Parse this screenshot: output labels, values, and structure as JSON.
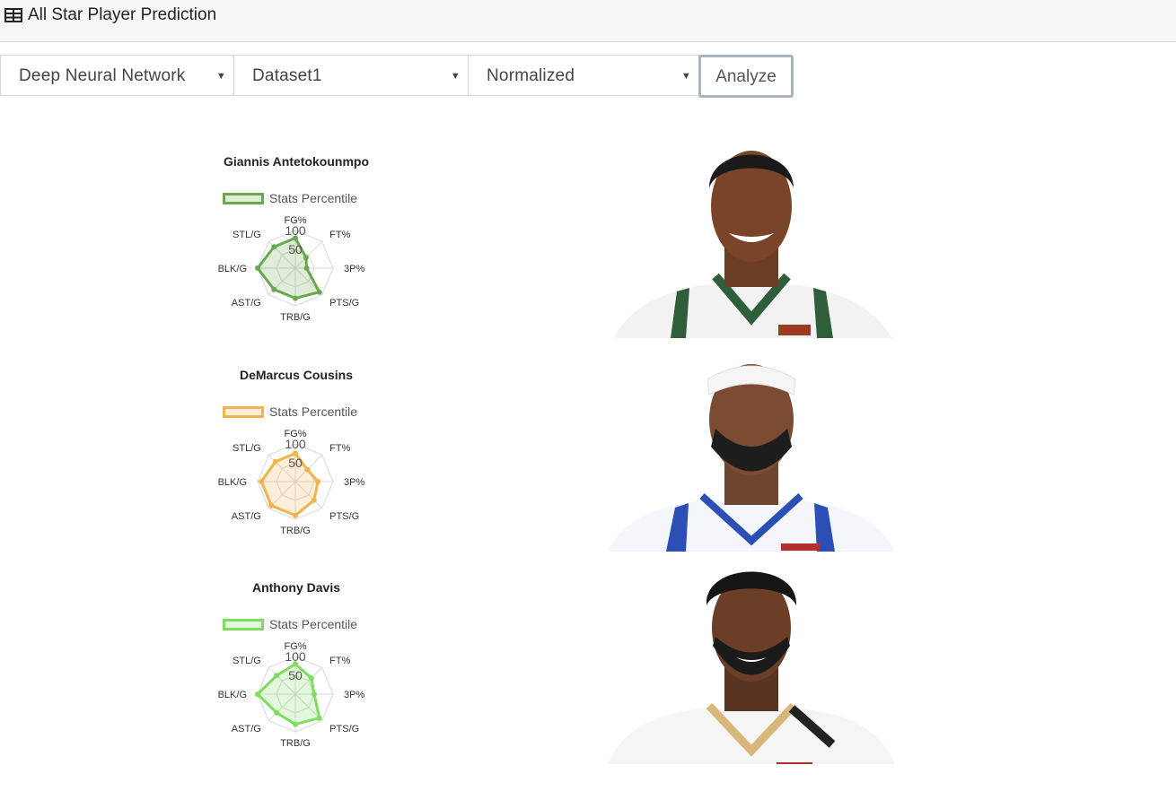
{
  "app": {
    "title": "All Star Player Prediction",
    "icon": "table-icon"
  },
  "controls": {
    "model": "Deep Neural Network",
    "dataset": "Dataset1",
    "normalization": "Normalized",
    "analyze_label": "Analyze"
  },
  "radar_axes": [
    "FG%",
    "FT%",
    "3P%",
    "PTS/G",
    "TRB/G",
    "AST/G",
    "BLK/G",
    "STL/G"
  ],
  "radar_ticks": [
    "50",
    "100"
  ],
  "players": [
    {
      "name": "Giannis Antetokounmpo",
      "legend": "Stats Percentile",
      "color": "#6aa84f",
      "fill": "rgba(106,168,79,0.22)",
      "jersey": "#f2f2f2",
      "trim": "#2e5e3a",
      "values": [
        80,
        40,
        30,
        90,
        80,
        80,
        100,
        80
      ]
    },
    {
      "name": "DeMarcus Cousins",
      "legend": "Stats Percentile",
      "color": "#f1b34c",
      "fill": "rgba(241,179,76,0.22)",
      "jersey": "#f4f6fb",
      "trim": "#2c4fb5",
      "values": [
        75,
        45,
        60,
        70,
        90,
        90,
        90,
        75
      ]
    },
    {
      "name": "Anthony Davis",
      "legend": "Stats Percentile",
      "color": "#7edc5e",
      "fill": "rgba(126,220,94,0.22)",
      "jersey": "#f5f5f5",
      "trim": "#d9b77b",
      "values": [
        80,
        60,
        50,
        90,
        80,
        70,
        100,
        70
      ]
    }
  ]
}
